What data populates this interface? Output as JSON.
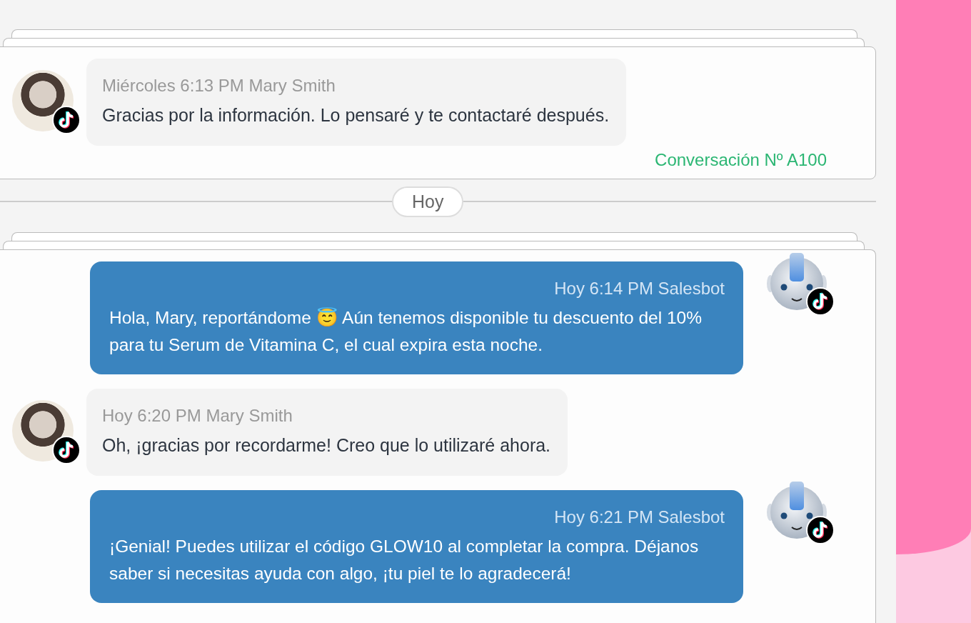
{
  "sections": [
    {
      "kind": "card",
      "messages": [
        {
          "kind": "customer",
          "meta": "Miércoles 6:13 PM Mary Smith",
          "text": "Gracias por la información. Lo pensaré y te contactaré después."
        }
      ],
      "footer": "Conversación Nº A100"
    },
    {
      "kind": "separator",
      "label": "Hoy"
    },
    {
      "kind": "card",
      "messages": [
        {
          "kind": "bot",
          "meta": "Hoy 6:14 PM Salesbot",
          "text": "Hola, Mary, reportándome 😇 Aún tenemos disponible tu descuento del 10% para tu Serum de Vitamina C, el cual expira esta noche."
        },
        {
          "kind": "customer",
          "meta": "Hoy 6:20 PM Mary Smith",
          "text": "Oh, ¡gracias por recordarme! Creo que lo utilizaré ahora."
        },
        {
          "kind": "bot",
          "meta": "Hoy 6:21 PM Salesbot",
          "text": "¡Genial! Puedes utilizar el código GLOW10 al completar la compra. Déjanos saber si necesitas ayuda con algo, ¡tu piel te lo agradecerá!"
        }
      ]
    }
  ]
}
